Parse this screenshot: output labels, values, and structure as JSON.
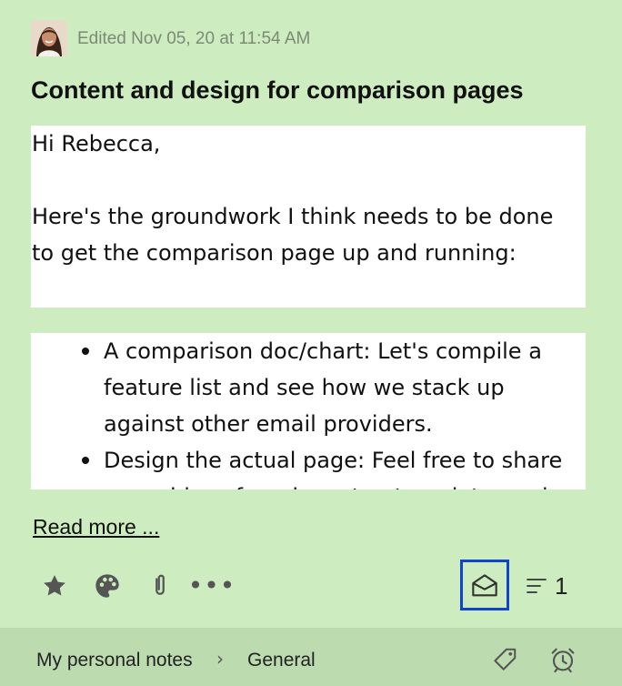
{
  "note": {
    "edited_text": "Edited Nov 05, 20 at 11:54 AM",
    "title": "Content and design for comparison pages",
    "greeting": "Hi Rebecca,",
    "intro": "Here's the groundwork I think needs to be done to get the comparison page up and running:",
    "bullets": [
      "A comparison doc/chart: Let's compile a feature list and see how we stack up against other email providers.",
      "Design the actual page: Feel free to share some ideas for a layout, a template, and how to set it up."
    ],
    "read_more": "Read more ..."
  },
  "toolbar": {
    "icons": [
      "star-icon",
      "palette-icon",
      "paperclip-icon",
      "more-icon",
      "envelope-open-icon",
      "lines-icon"
    ],
    "more_label": "•••",
    "count": "1"
  },
  "footer": {
    "notebook": "My personal notes",
    "separator": "›",
    "section": "General",
    "icons": [
      "tag-icon",
      "alarm-icon"
    ]
  },
  "colors": {
    "background": "#cdecc0",
    "footer_background": "#bcdcb0",
    "highlight_border": "#1342cc",
    "muted_text": "#7c8a76"
  }
}
